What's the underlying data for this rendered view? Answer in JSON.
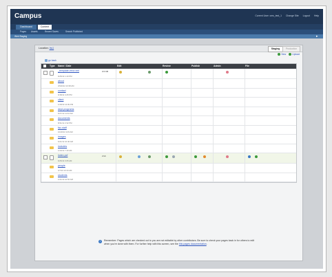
{
  "app": {
    "logo": "Campus"
  },
  "topbar": {
    "links": [
      "Current User: cms_test_1",
      "Change Site",
      "Logout",
      "Help"
    ]
  },
  "nav": {
    "tabs": [
      "Dashboard",
      "Content"
    ],
    "sub": [
      "Pages",
      "Assets",
      "Recent Saves",
      "Search Published"
    ]
  },
  "breadcrumb": {
    "label": "Web Staging"
  },
  "location": {
    "label": "Location:",
    "path": "/ss1",
    "staging_label": "Staging",
    "production_label": "Production"
  },
  "actions": {
    "new_label": "New",
    "upload_label": "Upload"
  },
  "uplink": {
    "label": "go back"
  },
  "table": {
    "headers": [
      "Type",
      "Name / Date",
      "Edit",
      "Review",
      "Publish",
      "Admin",
      "File"
    ],
    "rows": [
      {
        "name": "_template-error.xml",
        "date": "6/25/13 1:43 PM",
        "size": "0.5 KB",
        "kind": "file",
        "checkbox": true
      },
      {
        "name": "about",
        "date": "3/9/2012 10:38 AM",
        "kind": "folder"
      },
      {
        "name": "contact",
        "date": "9/18/12 4:25 PM",
        "kind": "folder"
      },
      {
        "name": "client",
        "date": "1/29/13 12:09 PM",
        "kind": "folder"
      },
      {
        "name": "dept-programs",
        "date": "6/27/12 11:42 AM",
        "kind": "folder"
      },
      {
        "name": "documents",
        "date": "8/31/12 2:32 PM",
        "kind": "folder"
      },
      {
        "name": "fac-staff",
        "date": "10/20/11 9:45 AM",
        "kind": "folder"
      },
      {
        "name": "images",
        "date": "6/21/12 10:46 AM",
        "kind": "folder"
      },
      {
        "name": "includes",
        "date": "1/20/13 7:40 AM",
        "kind": "folder"
      },
      {
        "name": "index.pcf",
        "date": "6/25/13 3:05 AM",
        "size": "2 kb",
        "kind": "file",
        "checkbox": true,
        "highlight": true
      },
      {
        "name": "people",
        "date": "4/7/10 10:44 AM",
        "kind": "folder"
      },
      {
        "name": "students",
        "date": "1/21/13 10:52 AM",
        "kind": "folder"
      }
    ]
  },
  "notice": {
    "text": "Remember: Pages which are checked out to you are not editable by other contributors. Be sure to check your pages back in for others to edit when you're done with them. For further help with this screen, see the ",
    "link": "this pages documentation",
    "end": "."
  },
  "colors": {
    "topbar": "#1f3553",
    "accent": "#4a7aab",
    "link": "#2a52be",
    "folder": "#f2c44b"
  }
}
